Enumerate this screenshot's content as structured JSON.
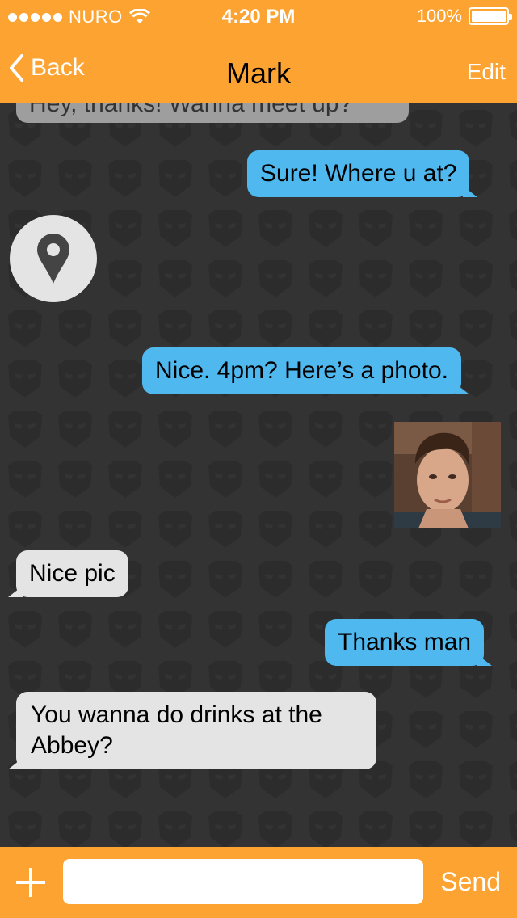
{
  "status_bar": {
    "carrier": "NURO",
    "time": "4:20 PM",
    "battery": "100%",
    "battery_level": 1.0
  },
  "nav": {
    "back_label": "Back",
    "title": "Mark",
    "edit_label": "Edit"
  },
  "messages": [
    {
      "direction": "incoming",
      "text": "Hey, thanks! Wanna meet up?"
    },
    {
      "direction": "outgoing",
      "text": "Sure! Where u at?"
    },
    {
      "direction": "incoming",
      "type": "location",
      "icon": "location-pin-icon"
    },
    {
      "direction": "outgoing",
      "text": "Nice. 4pm? Here’s a photo."
    },
    {
      "direction": "outgoing",
      "type": "photo"
    },
    {
      "direction": "incoming",
      "text": "Nice pic"
    },
    {
      "direction": "outgoing",
      "text": "Thanks man"
    },
    {
      "direction": "incoming",
      "text": "You wanna do drinks at the Abbey?"
    }
  ],
  "composer": {
    "input_value": "",
    "send_label": "Send",
    "add_icon": "plus-icon"
  },
  "colors": {
    "accent": "#FDA331",
    "outgoing_bubble": "#4FB8EF",
    "incoming_bubble": "#E4E4E4",
    "background": "#333333"
  }
}
